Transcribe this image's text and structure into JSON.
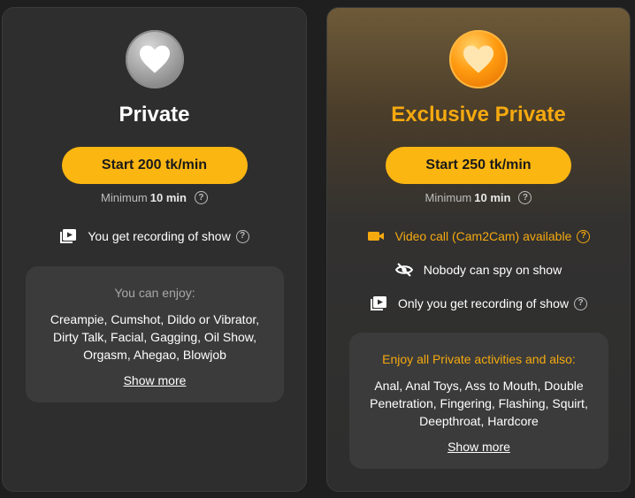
{
  "private": {
    "title": "Private",
    "start_button": "Start 200 tk/min",
    "minimum_prefix": "Minimum",
    "minimum_value": "10 min",
    "features": [
      {
        "label": "You get recording of show",
        "icon": "video-play-icon"
      }
    ],
    "enjoy_heading": "You can enjoy:",
    "enjoy_list": "Creampie, Cumshot, Dildo or Vibrator, Dirty Talk, Facial, Gagging, Oil Show, Orgasm, Ahegao, Blowjob",
    "show_more": "Show more"
  },
  "exclusive": {
    "title": "Exclusive Private",
    "start_button": "Start 250 tk/min",
    "minimum_prefix": "Minimum",
    "minimum_value": "10 min",
    "features": [
      {
        "label": "Video call (Cam2Cam) available",
        "icon": "camera-icon"
      },
      {
        "label": "Nobody can spy on show",
        "icon": "eye-off-icon"
      },
      {
        "label": "Only you get recording of show",
        "icon": "video-play-icon"
      }
    ],
    "enjoy_heading": "Enjoy all Private activities and also:",
    "enjoy_list": "Anal, Anal Toys, Ass to Mouth, Double Penetration, Fingering, Flashing, Squirt, Deepthroat, Hardcore",
    "show_more": "Show more"
  },
  "colors": {
    "accent": "#fcb612",
    "gold_text": "#f5a90f",
    "card_bg": "#2e2e2e",
    "box_bg": "#3b3b3b"
  }
}
